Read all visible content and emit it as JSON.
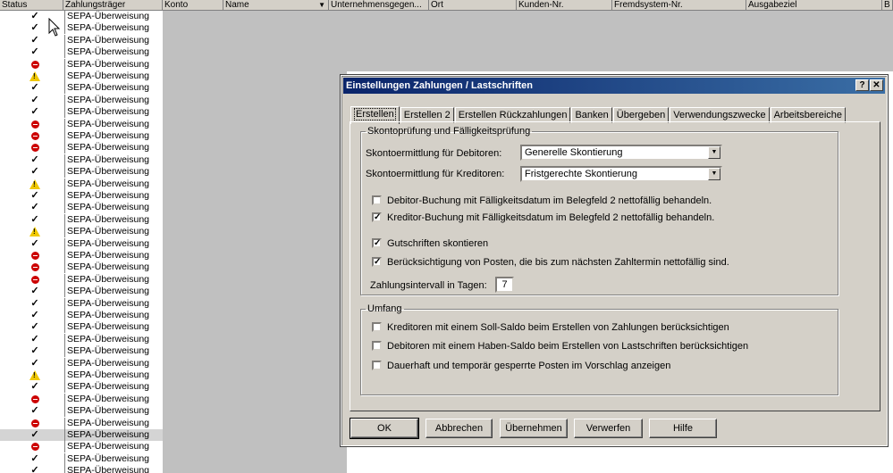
{
  "grid": {
    "headers": [
      "Status",
      "Zahlungsträger",
      "Konto",
      "Name",
      "Unternehmensgegen...",
      "Ort",
      "Kunden-Nr.",
      "Fremdsystem-Nr.",
      "Ausgabeziel",
      "B"
    ],
    "rows": [
      {
        "status": "ok",
        "zahlungstraeger": "SEPA-Überweisung"
      },
      {
        "status": "ok",
        "zahlungstraeger": "SEPA-Überweisung"
      },
      {
        "status": "ok",
        "zahlungstraeger": "SEPA-Überweisung"
      },
      {
        "status": "ok",
        "zahlungstraeger": "SEPA-Überweisung"
      },
      {
        "status": "error",
        "zahlungstraeger": "SEPA-Überweisung"
      },
      {
        "status": "warning",
        "zahlungstraeger": "SEPA-Überweisung"
      },
      {
        "status": "ok",
        "zahlungstraeger": "SEPA-Überweisung"
      },
      {
        "status": "ok",
        "zahlungstraeger": "SEPA-Überweisung"
      },
      {
        "status": "ok",
        "zahlungstraeger": "SEPA-Überweisung"
      },
      {
        "status": "error",
        "zahlungstraeger": "SEPA-Überweisung"
      },
      {
        "status": "error",
        "zahlungstraeger": "SEPA-Überweisung"
      },
      {
        "status": "error",
        "zahlungstraeger": "SEPA-Überweisung"
      },
      {
        "status": "ok",
        "zahlungstraeger": "SEPA-Überweisung"
      },
      {
        "status": "ok",
        "zahlungstraeger": "SEPA-Überweisung"
      },
      {
        "status": "warning",
        "zahlungstraeger": "SEPA-Überweisung"
      },
      {
        "status": "ok",
        "zahlungstraeger": "SEPA-Überweisung"
      },
      {
        "status": "ok",
        "zahlungstraeger": "SEPA-Überweisung"
      },
      {
        "status": "ok",
        "zahlungstraeger": "SEPA-Überweisung"
      },
      {
        "status": "warning",
        "zahlungstraeger": "SEPA-Überweisung"
      },
      {
        "status": "ok",
        "zahlungstraeger": "SEPA-Überweisung"
      },
      {
        "status": "error",
        "zahlungstraeger": "SEPA-Überweisung"
      },
      {
        "status": "error",
        "zahlungstraeger": "SEPA-Überweisung"
      },
      {
        "status": "error",
        "zahlungstraeger": "SEPA-Überweisung"
      },
      {
        "status": "ok",
        "zahlungstraeger": "SEPA-Überweisung"
      },
      {
        "status": "ok",
        "zahlungstraeger": "SEPA-Überweisung"
      },
      {
        "status": "ok",
        "zahlungstraeger": "SEPA-Überweisung"
      },
      {
        "status": "ok",
        "zahlungstraeger": "SEPA-Überweisung"
      },
      {
        "status": "ok",
        "zahlungstraeger": "SEPA-Überweisung"
      },
      {
        "status": "ok",
        "zahlungstraeger": "SEPA-Überweisung"
      },
      {
        "status": "ok",
        "zahlungstraeger": "SEPA-Überweisung"
      },
      {
        "status": "warning",
        "zahlungstraeger": "SEPA-Überweisung"
      },
      {
        "status": "ok",
        "zahlungstraeger": "SEPA-Überweisung"
      },
      {
        "status": "error",
        "zahlungstraeger": "SEPA-Überweisung"
      },
      {
        "status": "ok",
        "zahlungstraeger": "SEPA-Überweisung"
      },
      {
        "status": "error",
        "zahlungstraeger": "SEPA-Überweisung"
      },
      {
        "status": "ok",
        "zahlungstraeger": "SEPA-Überweisung",
        "selected": true
      },
      {
        "status": "error",
        "zahlungstraeger": "SEPA-Überweisung"
      },
      {
        "status": "ok",
        "zahlungstraeger": "SEPA-Überweisung"
      },
      {
        "status": "ok",
        "zahlungstraeger": "SEPA-Überweisung"
      }
    ]
  },
  "dialog": {
    "title": "Einstellungen Zahlungen / Lastschriften",
    "help_button": "?",
    "close_button": "✕",
    "tabs": [
      "Erstellen",
      "Erstellen 2",
      "Erstellen Rückzahlungen",
      "Banken",
      "Übergeben",
      "Verwendungszwecke",
      "Arbeitsbereiche"
    ],
    "group1": {
      "legend": "Skontoprüfung und Fälligkeitsprüfung",
      "debitoren_label": "Skontoermittlung für Debitoren:",
      "debitoren_value": "Generelle Skontierung",
      "kreditoren_label": "Skontoermittlung für Kreditoren:",
      "kreditoren_value": "Fristgerechte Skontierung",
      "checkboxes": [
        {
          "label": "Debitor-Buchung mit Fälligkeitsdatum im Belegfeld 2 nettofällig behandeln.",
          "checked": false
        },
        {
          "label": "Kreditor-Buchung mit Fälligkeitsdatum im Belegfeld 2 nettofällig behandeln.",
          "checked": true
        },
        {
          "label": "Gutschriften skontieren",
          "checked": true
        },
        {
          "label": "Berücksichtigung von Posten, die bis zum nächsten Zahltermin nettofällig sind.",
          "checked": true
        }
      ],
      "intervall_label": "Zahlungsintervall in Tagen:",
      "intervall_value": "7"
    },
    "group2": {
      "legend": "Umfang",
      "checkboxes": [
        {
          "label": "Kreditoren mit einem Soll-Saldo beim Erstellen von Zahlungen berücksichtigen",
          "checked": false
        },
        {
          "label": "Debitoren mit einem Haben-Saldo beim Erstellen von Lastschriften berücksichtigen",
          "checked": false
        },
        {
          "label": "Dauerhaft und temporär gesperrte Posten im Vorschlag anzeigen",
          "checked": false
        }
      ]
    },
    "buttons": {
      "ok": "OK",
      "abbrechen": "Abbrechen",
      "uebernehmen": "Übernehmen",
      "verwerfen": "Verwerfen",
      "hilfe": "Hilfe"
    }
  }
}
